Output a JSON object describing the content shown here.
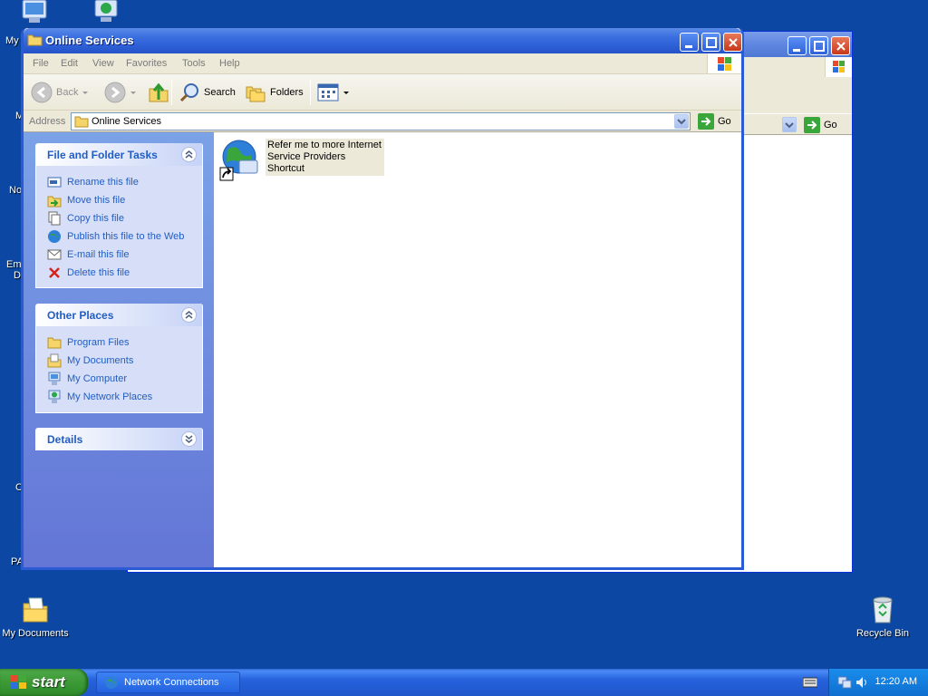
{
  "desktop": {
    "icons": [
      {
        "name": "my-documents",
        "label": "My Documents",
        "icon": "folder-documents-icon"
      },
      {
        "name": "recycle-bin",
        "label": "Recycle Bin",
        "icon": "recycle-bin-icon"
      }
    ],
    "edge_labels": [
      "My",
      "M",
      "No",
      "Em",
      "D",
      "C",
      "PA"
    ]
  },
  "back_window": {
    "go_label": "Go"
  },
  "window": {
    "title": "Online Services",
    "menu": [
      "File",
      "Edit",
      "View",
      "Favorites",
      "Tools",
      "Help"
    ],
    "toolbar": {
      "back": "Back",
      "search": "Search",
      "folders": "Folders"
    },
    "address": {
      "label": "Address",
      "value": "Online Services",
      "go": "Go"
    },
    "task_pane": {
      "file_tasks": {
        "title": "File and Folder Tasks",
        "items": [
          {
            "label": "Rename this file",
            "icon": "rename-icon"
          },
          {
            "label": "Move this file",
            "icon": "move-icon"
          },
          {
            "label": "Copy this file",
            "icon": "copy-icon"
          },
          {
            "label": "Publish this file to the Web",
            "icon": "globe-icon"
          },
          {
            "label": "E-mail this file",
            "icon": "email-icon"
          },
          {
            "label": "Delete this file",
            "icon": "delete-icon"
          }
        ]
      },
      "other_places": {
        "title": "Other Places",
        "items": [
          {
            "label": "Program Files",
            "icon": "folder-icon"
          },
          {
            "label": "My Documents",
            "icon": "documents-icon"
          },
          {
            "label": "My Computer",
            "icon": "computer-icon"
          },
          {
            "label": "My Network Places",
            "icon": "network-icon"
          }
        ]
      },
      "details": {
        "title": "Details"
      }
    },
    "files": [
      {
        "line1": "Refer me to more Internet",
        "line2": "Service Providers",
        "line3": "Shortcut",
        "icon": "globe-shortcut-icon"
      }
    ]
  },
  "taskbar": {
    "start": "start",
    "tasks": [
      {
        "label": "Network Connections",
        "icon": "network-connections-icon"
      }
    ],
    "clock": "12:20 AM"
  },
  "colors": {
    "desktop": "#0b47a3",
    "task_link": "#215dc6",
    "title_bar": "#2d5fd6"
  }
}
